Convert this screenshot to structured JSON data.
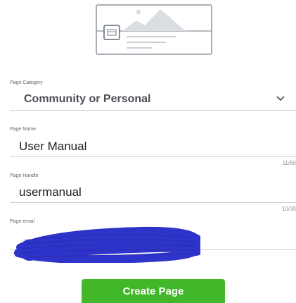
{
  "form": {
    "category": {
      "label": "Page Category",
      "value": "Community or Personal"
    },
    "name": {
      "label": "Page Name",
      "value": "User Manual",
      "counter": "11/60"
    },
    "handle": {
      "label": "Page Handle",
      "value": "usermanual",
      "counter": "10/30"
    },
    "email": {
      "label": "Page email"
    },
    "submit_label": "Create Page"
  },
  "icons": {
    "illustration": "page-preview-illustration-icon",
    "dropdown": "chevron-down-icon",
    "redaction": "scribble-redaction"
  },
  "colors": {
    "primary_button": "#42b72a",
    "redaction": "#2e34c9"
  }
}
